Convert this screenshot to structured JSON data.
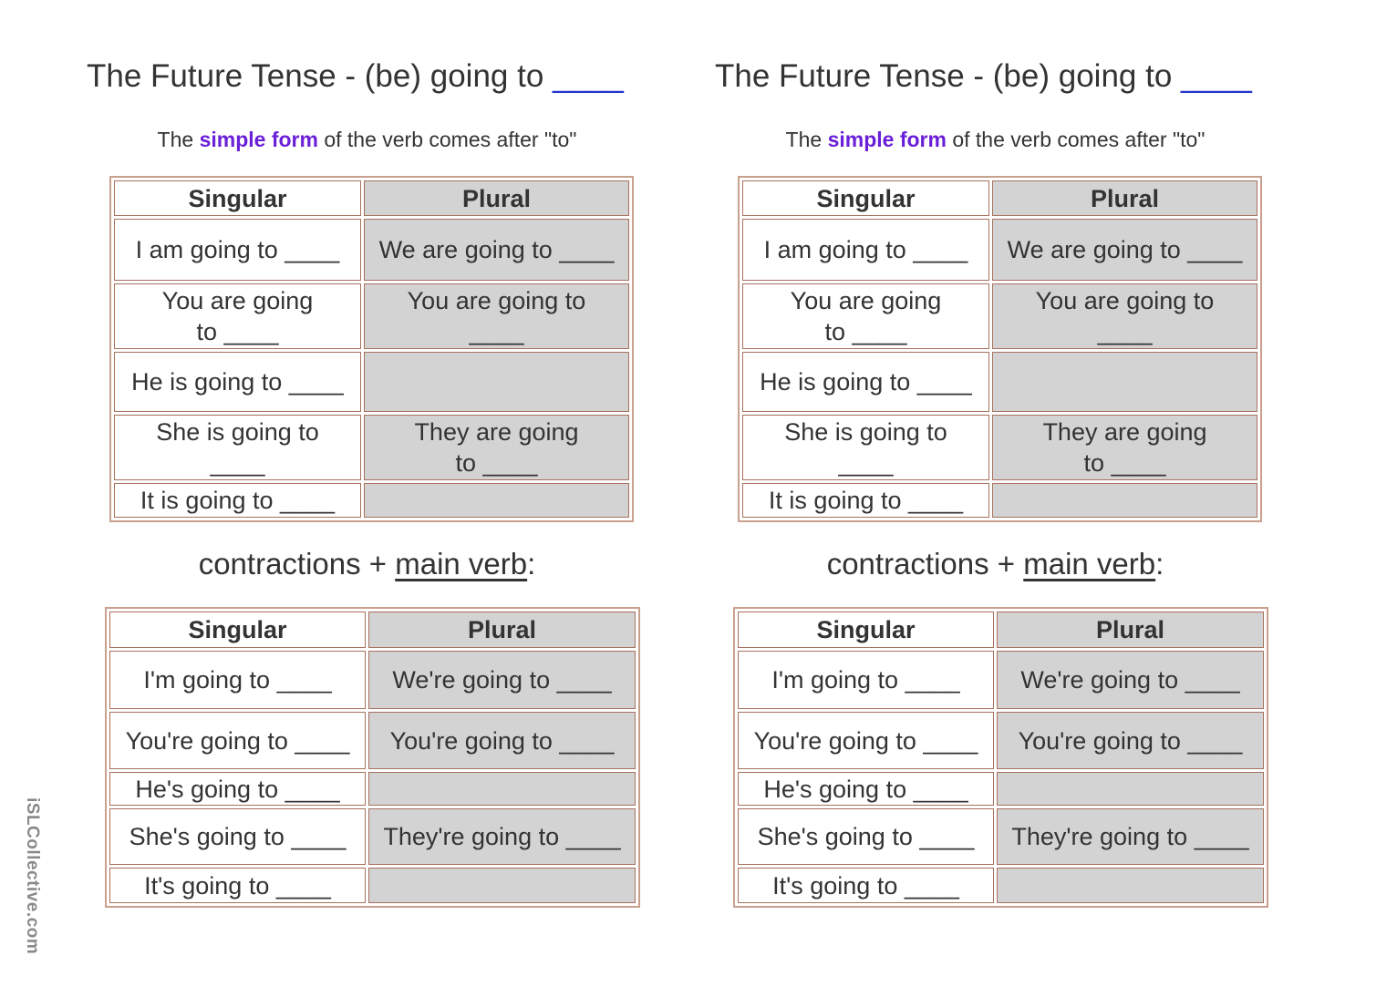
{
  "watermark": "iSLCollective.com",
  "colors": {
    "highlight": "#6a1fd8",
    "title_blank": "#2233cc",
    "plural_bg": "#d3d3d3",
    "border": "#a8715e"
  },
  "panels": [
    {
      "title": "The Future Tense - (be) going to",
      "title_blank": "____",
      "subtitle": {
        "pre": "The",
        "highlight": "simple form",
        "post": "of the verb comes after \"to\""
      },
      "table1": {
        "headers": [
          "Singular",
          "Plural"
        ],
        "rows": [
          [
            "I am going to ____",
            "We are going to ____"
          ],
          [
            "You are going to ____",
            "You are going to ____"
          ],
          [
            "He is going to ____",
            ""
          ],
          [
            "She is going to ____",
            "They are going to ____"
          ],
          [
            "It is going to ____",
            ""
          ]
        ]
      },
      "contractions_heading": {
        "pre": "contractions + ",
        "underlined": "main verb",
        "post": ":"
      },
      "table2": {
        "headers": [
          "Singular",
          "Plural"
        ],
        "rows": [
          [
            "I'm going to ____",
            "We're going to ____"
          ],
          [
            "You're going to ____",
            "You're going to ____"
          ],
          [
            "He's going to ____",
            ""
          ],
          [
            "She's going to ____",
            "They're going to ____"
          ],
          [
            "It's going to ____",
            ""
          ]
        ]
      }
    },
    {
      "title": "The Future Tense - (be) going to",
      "title_blank": "____",
      "subtitle": {
        "pre": "The",
        "highlight": "simple form",
        "post": "of the verb comes after \"to\""
      },
      "table1": {
        "headers": [
          "Singular",
          "Plural"
        ],
        "rows": [
          [
            "I am going to ____",
            "We are going to ____"
          ],
          [
            "You are going to ____",
            "You are going to ____"
          ],
          [
            "He is going to ____",
            ""
          ],
          [
            "She is going to ____",
            "They are going to ____"
          ],
          [
            "It is going to ____",
            ""
          ]
        ]
      },
      "contractions_heading": {
        "pre": "contractions + ",
        "underlined": "main verb",
        "post": ":"
      },
      "table2": {
        "headers": [
          "Singular",
          "Plural"
        ],
        "rows": [
          [
            "I'm going to ____",
            "We're going to ____"
          ],
          [
            "You're going to ____",
            "You're going to ____"
          ],
          [
            "He's going to ____",
            ""
          ],
          [
            "She's going to ____",
            "They're going to ____"
          ],
          [
            "It's going to ____",
            ""
          ]
        ]
      }
    }
  ]
}
